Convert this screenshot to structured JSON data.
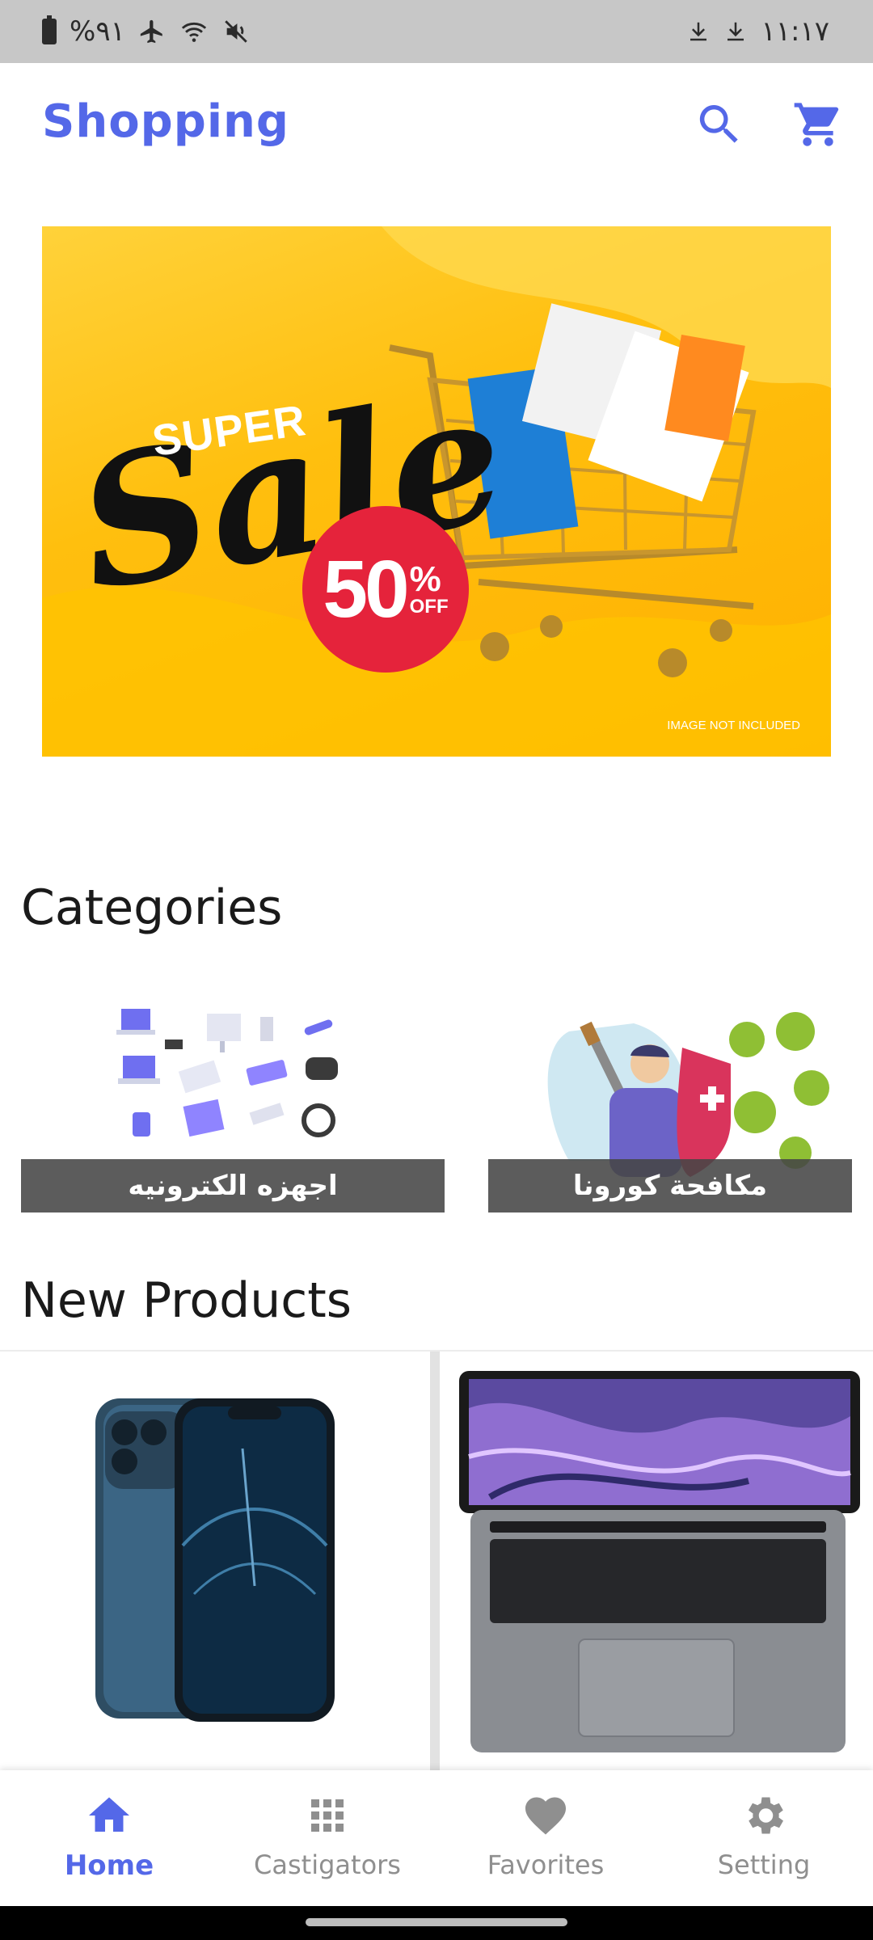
{
  "status_bar": {
    "battery_text": "%٩١",
    "time": "١١:١٧",
    "icons": [
      "battery-icon",
      "airplane-icon",
      "wifi-icon",
      "mute-icon",
      "download-icon",
      "download-icon"
    ]
  },
  "app_bar": {
    "title": "Shopping",
    "actions": [
      "search-icon",
      "cart-icon"
    ]
  },
  "banner": {
    "super_text": "SUPER",
    "sale_text": "Sale",
    "discount_value": "50",
    "discount_percent": "%",
    "discount_off": "OFF",
    "disclaimer": "IMAGE NOT INCLUDED"
  },
  "sections": {
    "categories": "Categories",
    "new_products": "New Products"
  },
  "categories": [
    {
      "label": "اجهزه الكترونيه"
    },
    {
      "label": "مكافحة كورونا"
    }
  ],
  "products": [
    {
      "image": "smartphone"
    },
    {
      "image": "laptop"
    }
  ],
  "bottom_nav": {
    "items": [
      {
        "label": "Home",
        "icon": "home-icon",
        "active": true
      },
      {
        "label": "Castigators",
        "icon": "grid-icon",
        "active": false
      },
      {
        "label": "Favorites",
        "icon": "heart-icon",
        "active": false
      },
      {
        "label": "Setting",
        "icon": "gear-icon",
        "active": false
      }
    ]
  },
  "colors": {
    "accent": "#5468e8",
    "inactive": "#8f8f8f",
    "banner_yellow": "#ffbf0e",
    "discount_red": "#e5233b",
    "status_bar": "#c7c7c7"
  }
}
